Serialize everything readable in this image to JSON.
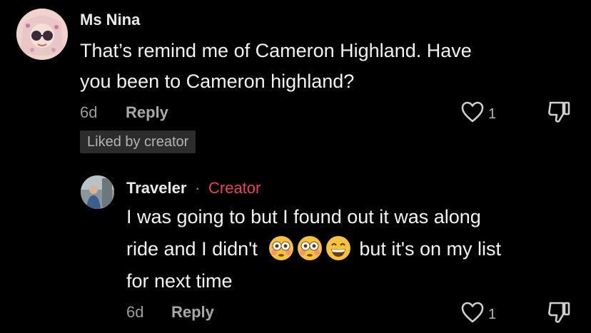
{
  "comments": [
    {
      "username": "Ms Nina",
      "text_lines": [
        "That’s remind me of Cameron Highland. Have",
        "you been to Cameron highland?"
      ],
      "time": "6d",
      "reply_label": "Reply",
      "likes": "1",
      "badge": "Liked by creator"
    },
    {
      "username": "Traveler",
      "separator": "·",
      "creator_label": "Creator",
      "text_line1": "I was going to but I found out it was along",
      "text_line2_a": "ride and I didn't",
      "text_line2_b": "but it's on my list",
      "text_line3": "for next time",
      "emojis": [
        "flushed-face-emoji",
        "flushed-face-emoji",
        "grinning-face-emoji"
      ],
      "time": "6d",
      "reply_label": "Reply",
      "likes": "1"
    }
  ],
  "colors": {
    "background": "#000000",
    "creator_accent": "#ea4359",
    "badge_bg": "#2c2c2c"
  }
}
